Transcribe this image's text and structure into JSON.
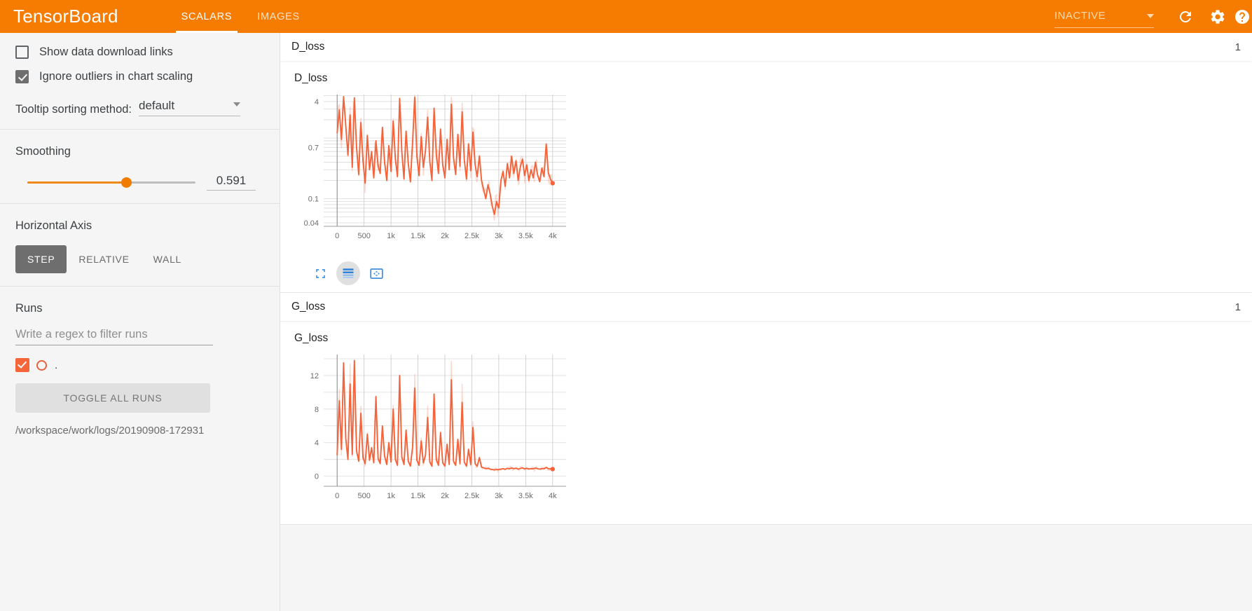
{
  "header": {
    "brand": "TensorBoard",
    "tabs": [
      {
        "label": "SCALARS",
        "active": true
      },
      {
        "label": "IMAGES",
        "active": false
      }
    ],
    "run_selector_value": "INACTIVE",
    "icons": {
      "caret": "chevron-down-icon",
      "reload": "reload-icon",
      "settings": "gear-icon",
      "help": "help-icon"
    },
    "accent_color": "#f57c00"
  },
  "sidebar": {
    "checkboxes": [
      {
        "label": "Show data download links",
        "checked": false
      },
      {
        "label": "Ignore outliers in chart scaling",
        "checked": true
      }
    ],
    "tooltip_sorting": {
      "label": "Tooltip sorting method:",
      "value": "default"
    },
    "smoothing": {
      "title": "Smoothing",
      "value": "0.591",
      "fraction": 0.591
    },
    "horizontal_axis": {
      "title": "Horizontal Axis",
      "options": [
        {
          "label": "STEP",
          "active": true
        },
        {
          "label": "RELATIVE",
          "active": false
        },
        {
          "label": "WALL",
          "active": false
        }
      ]
    },
    "runs": {
      "title": "Runs",
      "filter_placeholder": "Write a regex to filter runs",
      "filter_value": "",
      "items": [
        {
          "name": ".",
          "checked": true,
          "color": "#e8603c"
        }
      ],
      "toggle_all_label": "TOGGLE ALL RUNS",
      "log_path": "/workspace/work/logs/20190908-172931"
    }
  },
  "main": {
    "cards": [
      {
        "header_title": "D_loss",
        "count": "1",
        "chart_title": "D_loss",
        "toolbar": [
          {
            "icon": "fullscreen-icon",
            "active": false
          },
          {
            "icon": "data-table-icon",
            "active": true
          },
          {
            "icon": "fit-domain-icon",
            "active": false
          }
        ]
      },
      {
        "header_title": "G_loss",
        "count": "1",
        "chart_title": "G_loss",
        "toolbar": [
          {
            "icon": "fullscreen-icon",
            "active": false
          },
          {
            "icon": "data-table-icon",
            "active": true
          },
          {
            "icon": "fit-domain-icon",
            "active": false
          }
        ]
      }
    ]
  },
  "chart_data": [
    {
      "type": "line",
      "title": "D_loss",
      "xlabel": "",
      "ylabel": "",
      "yscale": "log",
      "xlim": [
        -250,
        4250
      ],
      "ylim": [
        0.035,
        5.2
      ],
      "yticks": [
        4,
        0.7,
        0.1,
        0.04
      ],
      "ytick_labels": [
        "4",
        "0.7",
        "0.1",
        "0.04"
      ],
      "xticks": [
        0,
        500,
        1000,
        1500,
        2000,
        2500,
        3000,
        3500,
        4000
      ],
      "xtick_labels": [
        "0",
        "500",
        "1k",
        "1.5k",
        "2k",
        "2.5k",
        "3k",
        "3.5k",
        "4k"
      ],
      "grid": true,
      "legend": false,
      "series": [
        {
          "name": ".",
          "color": "#f4633a",
          "x": [
            0,
            40,
            80,
            120,
            160,
            200,
            240,
            280,
            320,
            360,
            400,
            440,
            480,
            520,
            560,
            600,
            640,
            680,
            720,
            760,
            800,
            840,
            880,
            920,
            960,
            1000,
            1040,
            1080,
            1120,
            1160,
            1200,
            1240,
            1280,
            1320,
            1360,
            1400,
            1440,
            1480,
            1520,
            1560,
            1600,
            1640,
            1680,
            1720,
            1760,
            1800,
            1840,
            1880,
            1920,
            1960,
            2000,
            2040,
            2080,
            2120,
            2160,
            2200,
            2240,
            2280,
            2320,
            2360,
            2400,
            2440,
            2480,
            2520,
            2560,
            2600,
            2640,
            2680,
            2720,
            2760,
            2800,
            2840,
            2880,
            2920,
            2960,
            3000,
            3040,
            3080,
            3120,
            3160,
            3200,
            3240,
            3280,
            3320,
            3360,
            3400,
            3440,
            3480,
            3520,
            3560,
            3600,
            3640,
            3680,
            3720,
            3760,
            3800,
            3840,
            3880,
            3920,
            3960,
            4000
          ],
          "y": [
            1.2,
            2.9,
            0.95,
            4.8,
            1.6,
            0.52,
            2.4,
            0.33,
            4.6,
            0.7,
            0.25,
            1.8,
            0.42,
            0.18,
            1.1,
            0.3,
            0.6,
            0.22,
            0.9,
            0.35,
            0.26,
            1.5,
            0.4,
            0.2,
            0.75,
            0.28,
            1.9,
            0.45,
            0.23,
            4.5,
            0.6,
            0.21,
            1.3,
            0.38,
            0.19,
            0.85,
            4.7,
            0.5,
            0.24,
            1.05,
            0.33,
            0.62,
            2.2,
            0.41,
            0.2,
            3.1,
            0.55,
            0.26,
            1.4,
            0.36,
            0.22,
            0.95,
            0.3,
            3.6,
            0.48,
            0.25,
            1.15,
            0.34,
            2.7,
            0.44,
            0.21,
            0.8,
            0.29,
            1.25,
            0.37,
            0.23,
            0.5,
            0.2,
            0.14,
            0.1,
            0.17,
            0.12,
            0.075,
            0.055,
            0.09,
            0.07,
            0.2,
            0.28,
            0.16,
            0.38,
            0.22,
            0.5,
            0.26,
            0.42,
            0.2,
            0.33,
            0.45,
            0.24,
            0.36,
            0.2,
            0.3,
            0.22,
            0.4,
            0.25,
            0.19,
            0.32,
            0.23,
            0.8,
            0.27,
            0.21,
            0.18
          ],
          "last_point": {
            "x": 4000,
            "y": 0.18
          }
        }
      ]
    },
    {
      "type": "line",
      "title": "G_loss",
      "xlabel": "",
      "ylabel": "",
      "yscale": "linear",
      "xlim": [
        -250,
        4250
      ],
      "ylim": [
        -1.2,
        14.5
      ],
      "yticks": [
        12,
        8,
        4,
        0
      ],
      "ytick_labels": [
        "12",
        "8",
        "4",
        "0"
      ],
      "xticks": [
        0,
        500,
        1000,
        1500,
        2000,
        2500,
        3000,
        3500,
        4000
      ],
      "xtick_labels": [
        "0",
        "500",
        "1k",
        "1.5k",
        "2k",
        "2.5k",
        "3k",
        "3.5k",
        "4k"
      ],
      "grid": true,
      "legend": false,
      "series": [
        {
          "name": ".",
          "color": "#f4633a",
          "x": [
            0,
            40,
            80,
            120,
            160,
            200,
            240,
            280,
            320,
            360,
            400,
            440,
            480,
            520,
            560,
            600,
            640,
            680,
            720,
            760,
            800,
            840,
            880,
            920,
            960,
            1000,
            1040,
            1080,
            1120,
            1160,
            1200,
            1240,
            1280,
            1320,
            1360,
            1400,
            1440,
            1480,
            1520,
            1560,
            1600,
            1640,
            1680,
            1720,
            1760,
            1800,
            1840,
            1880,
            1920,
            1960,
            2000,
            2040,
            2080,
            2120,
            2160,
            2200,
            2240,
            2280,
            2320,
            2360,
            2400,
            2440,
            2480,
            2520,
            2560,
            2600,
            2640,
            2680,
            2720,
            2760,
            2800,
            2840,
            2880,
            2920,
            2960,
            3000,
            3040,
            3080,
            3120,
            3160,
            3200,
            3240,
            3280,
            3320,
            3360,
            3400,
            3440,
            3480,
            3520,
            3560,
            3600,
            3640,
            3680,
            3720,
            3760,
            3800,
            3840,
            3880,
            3920,
            3960,
            4000
          ],
          "y": [
            2.5,
            9.0,
            3.2,
            13.5,
            4.5,
            2.0,
            11.0,
            2.6,
            13.8,
            3.0,
            1.8,
            7.5,
            2.2,
            1.5,
            5.0,
            1.9,
            3.4,
            1.6,
            9.5,
            2.1,
            1.5,
            6.0,
            2.4,
            1.4,
            4.0,
            1.7,
            8.0,
            2.0,
            1.3,
            12.0,
            2.3,
            1.4,
            5.5,
            1.8,
            1.2,
            3.5,
            10.5,
            1.9,
            1.3,
            4.2,
            1.6,
            2.5,
            7.0,
            1.7,
            1.2,
            9.8,
            2.0,
            1.3,
            5.2,
            1.6,
            1.2,
            3.8,
            1.4,
            11.5,
            1.8,
            1.3,
            4.4,
            1.5,
            8.8,
            1.7,
            1.2,
            3.2,
            1.4,
            5.8,
            1.5,
            1.2,
            2.2,
            1.1,
            1.0,
            0.9,
            0.95,
            0.85,
            0.8,
            0.75,
            0.8,
            0.78,
            0.85,
            0.9,
            0.82,
            0.95,
            0.88,
            1.0,
            0.9,
            0.95,
            0.85,
            0.92,
            1.0,
            0.88,
            0.95,
            0.86,
            0.9,
            0.88,
            0.98,
            0.9,
            0.85,
            0.92,
            0.88,
            1.05,
            0.9,
            0.87,
            0.85
          ],
          "last_point": {
            "x": 4000,
            "y": 0.85
          }
        }
      ]
    }
  ]
}
